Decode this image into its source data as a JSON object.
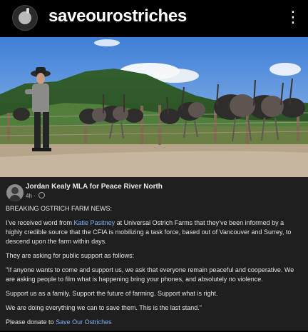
{
  "header": {
    "account_name": "saveourostriches",
    "more_icon": "more-vertical-icon"
  },
  "post": {
    "author": "Jordan Kealy MLA for Peace River North",
    "time": "4h",
    "heading": "BREAKING OSTRICH FARM NEWS:",
    "para1_before": "I’ve received word from ",
    "para1_link": "Katie Pasitney",
    "para1_after": " at Universal Ostrich Farms that they’ve been informed by a highly credible source that the CFIA is mobilizing a task force, based out of Vancouver and Surrey, to descend upon the farm within days.",
    "para2": "They are asking for public support as follows:",
    "para3": "\"If anyone wants to come and support us, we ask that everyone remain peaceful and cooperative. We are asking people to film what is happening bring your phones, and absolutely no violence.",
    "para4": "Support us as a family. Support the future of farming. Support what is right.",
    "para5": "We are doing everything we can to save them. This is the last stand.\"",
    "donate_prefix": "Please donate to ",
    "donate_link": "Save Our Ostriches"
  },
  "colors": {
    "background": "#000000",
    "card": "#1f1f1f",
    "link": "#7fb3ff"
  }
}
